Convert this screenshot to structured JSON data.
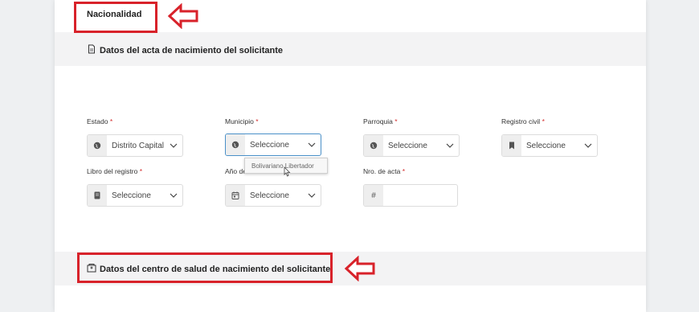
{
  "nacionalidad": "Nacionalidad",
  "section1": {
    "title": "Datos del acta de nacimiento del solicitante"
  },
  "section2": {
    "title": "Datos del centro de salud de nacimiento del solicitante"
  },
  "fields": {
    "estado": {
      "label": "Estado",
      "value": "Distrito Capital"
    },
    "municipio": {
      "label": "Municipio",
      "value": "Seleccione"
    },
    "parroquia": {
      "label": "Parroquia",
      "value": "Seleccione"
    },
    "registro_civil": {
      "label": "Registro civil",
      "value": "Seleccione"
    },
    "libro": {
      "label": "Libro del registro",
      "value": "Seleccione"
    },
    "anio": {
      "label": "Año de",
      "value": "Seleccione"
    },
    "nro_acta": {
      "label": "Nro. de acta",
      "value": ""
    }
  },
  "required_mark": "*",
  "municipio_dropdown": {
    "option": "Bolivariano Libertador"
  },
  "hash_symbol": "#",
  "colors": {
    "highlight_red": "#d8222a",
    "focus_blue": "#4a90c8",
    "required_red": "#d32f2f"
  }
}
